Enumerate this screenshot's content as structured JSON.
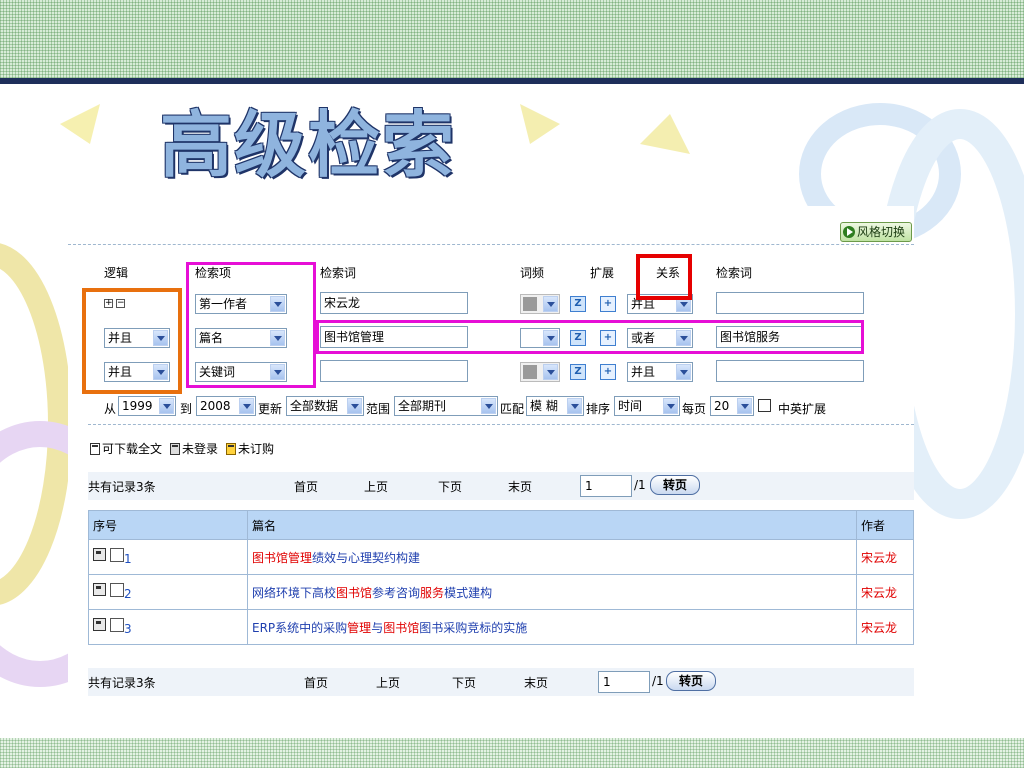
{
  "slide": {
    "title": "高级检索"
  },
  "page": {
    "style_switch_label": "风格切换"
  },
  "form": {
    "headers": {
      "logic": "逻辑",
      "field": "检索项",
      "term": "检索词",
      "freq": "词频",
      "expand": "扩展",
      "relation": "关系",
      "term2": "检索词"
    },
    "plus_minus": [
      "+",
      "−"
    ],
    "rows": [
      {
        "logic": "",
        "field": "第一作者",
        "term": "宋云龙",
        "relation": "并且",
        "term2": ""
      },
      {
        "logic": "并且",
        "field": "篇名",
        "term": "图书馆管理",
        "relation": "或者",
        "term2": "图书馆服务"
      },
      {
        "logic": "并且",
        "field": "关键词",
        "term": "",
        "relation": "并且",
        "term2": ""
      }
    ],
    "filters": {
      "from_label": "从",
      "from_year": "1999",
      "to_label": "到",
      "to_year": "2008",
      "update_label": "更新",
      "update_value": "全部数据",
      "scope_label": "范围",
      "scope_value": "全部期刊",
      "match_label": "匹配",
      "match_value": "模 糊",
      "sort_label": "排序",
      "sort_value": "时间",
      "per_page_label": "每页",
      "per_page_value": "20",
      "cn_en_expand_label": "中英扩展"
    }
  },
  "legend": {
    "downloadable": "可下载全文",
    "not_logged_in": "未登录",
    "not_subscribed": "未订购"
  },
  "pager": {
    "total": "共有记录3条",
    "first": "首页",
    "prev": "上页",
    "next": "下页",
    "last": "末页",
    "page_value": "1",
    "page_total": "/1",
    "go": "转页"
  },
  "results": {
    "columns": [
      "序号",
      "篇名",
      "作者"
    ],
    "rows": [
      {
        "num": "1",
        "title_parts": [
          {
            "text": "图书馆管理",
            "hl": true
          },
          {
            "text": "绩效与心理契约构建",
            "hl": false
          }
        ],
        "author": "宋云龙"
      },
      {
        "num": "2",
        "title_parts": [
          {
            "text": "网络环境下高校",
            "hl": false
          },
          {
            "text": "图书馆",
            "hl": true
          },
          {
            "text": "参考咨询",
            "hl": false
          },
          {
            "text": "服务",
            "hl": true
          },
          {
            "text": "模式建构",
            "hl": false
          }
        ],
        "author": "宋云龙"
      },
      {
        "num": "3",
        "title_parts": [
          {
            "text": "ERP系统中的采购",
            "hl": false
          },
          {
            "text": "管理",
            "hl": true
          },
          {
            "text": "与",
            "hl": false
          },
          {
            "text": "图书馆",
            "hl": true
          },
          {
            "text": "图书采购竞标的实施",
            "hl": false
          }
        ],
        "author": "宋云龙"
      }
    ]
  },
  "colors": {
    "highlight_orange": "#e8700e",
    "highlight_magenta": "#e60fd6",
    "highlight_red": "#e60000",
    "keyword_red": "#e00000",
    "title_blue": "#1f3fae",
    "header_bg": "#b9d6f5"
  }
}
